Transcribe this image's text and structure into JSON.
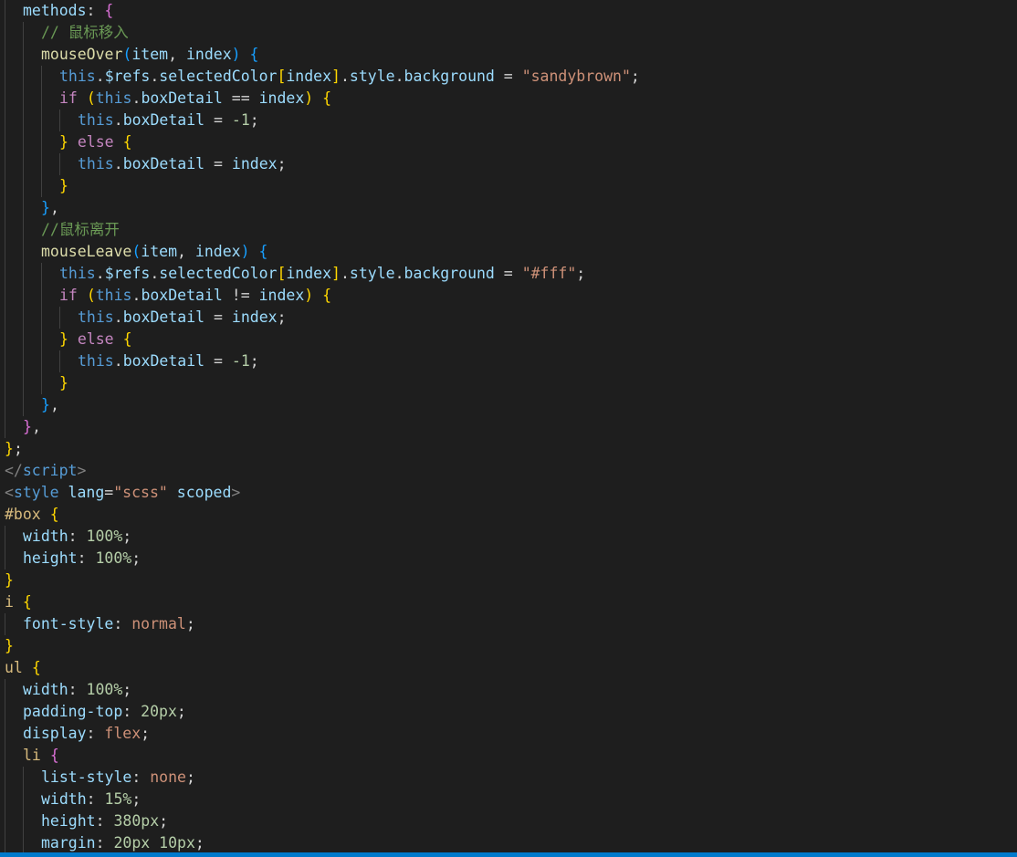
{
  "colors": {
    "background": "#1e1e1e",
    "statusbar": "#007acc",
    "indent_guide": "#404040",
    "default": "#d4d4d4",
    "keyword": "#569cd6",
    "control": "#c586c0",
    "function": "#dcdcaa",
    "variable": "#9cdcfe",
    "string": "#ce9178",
    "number": "#b5cea8",
    "comment": "#6a9955",
    "tag": "#808080",
    "selector": "#d7ba7d",
    "bracket1": "#ffd700",
    "bracket2": "#da70d6",
    "bracket3": "#179fff"
  },
  "code": {
    "lines": [
      {
        "indent": 1,
        "tokens": [
          [
            "methods",
            "variable"
          ],
          [
            ": ",
            "default"
          ],
          [
            "{",
            "bracket2"
          ]
        ]
      },
      {
        "indent": 2,
        "tokens": [
          [
            "// 鼠标移入",
            "comment"
          ]
        ]
      },
      {
        "indent": 2,
        "tokens": [
          [
            "mouseOver",
            "function"
          ],
          [
            "(",
            "bracket3"
          ],
          [
            "item",
            "variable"
          ],
          [
            ", ",
            "default"
          ],
          [
            "index",
            "variable"
          ],
          [
            ")",
            "bracket3"
          ],
          [
            " ",
            "default"
          ],
          [
            "{",
            "bracket3"
          ]
        ]
      },
      {
        "indent": 3,
        "tokens": [
          [
            "this",
            "keyword"
          ],
          [
            ".",
            "default"
          ],
          [
            "$refs",
            "variable"
          ],
          [
            ".",
            "default"
          ],
          [
            "selectedColor",
            "variable"
          ],
          [
            "[",
            "bracket1"
          ],
          [
            "index",
            "variable"
          ],
          [
            "]",
            "bracket1"
          ],
          [
            ".",
            "default"
          ],
          [
            "style",
            "variable"
          ],
          [
            ".",
            "default"
          ],
          [
            "background",
            "variable"
          ],
          [
            " = ",
            "default"
          ],
          [
            "\"sandybrown\"",
            "string"
          ],
          [
            ";",
            "default"
          ]
        ]
      },
      {
        "indent": 3,
        "tokens": [
          [
            "if",
            "control"
          ],
          [
            " ",
            "default"
          ],
          [
            "(",
            "bracket1"
          ],
          [
            "this",
            "keyword"
          ],
          [
            ".",
            "default"
          ],
          [
            "boxDetail",
            "variable"
          ],
          [
            " == ",
            "default"
          ],
          [
            "index",
            "variable"
          ],
          [
            ")",
            "bracket1"
          ],
          [
            " ",
            "default"
          ],
          [
            "{",
            "bracket1"
          ]
        ]
      },
      {
        "indent": 4,
        "tokens": [
          [
            "this",
            "keyword"
          ],
          [
            ".",
            "default"
          ],
          [
            "boxDetail",
            "variable"
          ],
          [
            " = ",
            "default"
          ],
          [
            "-1",
            "number"
          ],
          [
            ";",
            "default"
          ]
        ]
      },
      {
        "indent": 3,
        "tokens": [
          [
            "}",
            "bracket1"
          ],
          [
            " ",
            "default"
          ],
          [
            "else",
            "control"
          ],
          [
            " ",
            "default"
          ],
          [
            "{",
            "bracket1"
          ]
        ]
      },
      {
        "indent": 4,
        "tokens": [
          [
            "this",
            "keyword"
          ],
          [
            ".",
            "default"
          ],
          [
            "boxDetail",
            "variable"
          ],
          [
            " = ",
            "default"
          ],
          [
            "index",
            "variable"
          ],
          [
            ";",
            "default"
          ]
        ]
      },
      {
        "indent": 3,
        "tokens": [
          [
            "}",
            "bracket1"
          ]
        ]
      },
      {
        "indent": 2,
        "tokens": [
          [
            "}",
            "bracket3"
          ],
          [
            ",",
            "default"
          ]
        ]
      },
      {
        "indent": 2,
        "tokens": [
          [
            "//鼠标离开",
            "comment"
          ]
        ]
      },
      {
        "indent": 2,
        "tokens": [
          [
            "mouseLeave",
            "function"
          ],
          [
            "(",
            "bracket3"
          ],
          [
            "item",
            "variable"
          ],
          [
            ", ",
            "default"
          ],
          [
            "index",
            "variable"
          ],
          [
            ")",
            "bracket3"
          ],
          [
            " ",
            "default"
          ],
          [
            "{",
            "bracket3"
          ]
        ]
      },
      {
        "indent": 3,
        "tokens": [
          [
            "this",
            "keyword"
          ],
          [
            ".",
            "default"
          ],
          [
            "$refs",
            "variable"
          ],
          [
            ".",
            "default"
          ],
          [
            "selectedColor",
            "variable"
          ],
          [
            "[",
            "bracket1"
          ],
          [
            "index",
            "variable"
          ],
          [
            "]",
            "bracket1"
          ],
          [
            ".",
            "default"
          ],
          [
            "style",
            "variable"
          ],
          [
            ".",
            "default"
          ],
          [
            "background",
            "variable"
          ],
          [
            " = ",
            "default"
          ],
          [
            "\"#fff\"",
            "string"
          ],
          [
            ";",
            "default"
          ]
        ]
      },
      {
        "indent": 3,
        "tokens": [
          [
            "if",
            "control"
          ],
          [
            " ",
            "default"
          ],
          [
            "(",
            "bracket1"
          ],
          [
            "this",
            "keyword"
          ],
          [
            ".",
            "default"
          ],
          [
            "boxDetail",
            "variable"
          ],
          [
            " != ",
            "default"
          ],
          [
            "index",
            "variable"
          ],
          [
            ")",
            "bracket1"
          ],
          [
            " ",
            "default"
          ],
          [
            "{",
            "bracket1"
          ]
        ]
      },
      {
        "indent": 4,
        "tokens": [
          [
            "this",
            "keyword"
          ],
          [
            ".",
            "default"
          ],
          [
            "boxDetail",
            "variable"
          ],
          [
            " = ",
            "default"
          ],
          [
            "index",
            "variable"
          ],
          [
            ";",
            "default"
          ]
        ]
      },
      {
        "indent": 3,
        "tokens": [
          [
            "}",
            "bracket1"
          ],
          [
            " ",
            "default"
          ],
          [
            "else",
            "control"
          ],
          [
            " ",
            "default"
          ],
          [
            "{",
            "bracket1"
          ]
        ]
      },
      {
        "indent": 4,
        "tokens": [
          [
            "this",
            "keyword"
          ],
          [
            ".",
            "default"
          ],
          [
            "boxDetail",
            "variable"
          ],
          [
            " = ",
            "default"
          ],
          [
            "-1",
            "number"
          ],
          [
            ";",
            "default"
          ]
        ]
      },
      {
        "indent": 3,
        "tokens": [
          [
            "}",
            "bracket1"
          ]
        ]
      },
      {
        "indent": 2,
        "tokens": [
          [
            "}",
            "bracket3"
          ],
          [
            ",",
            "default"
          ]
        ]
      },
      {
        "indent": 1,
        "tokens": [
          [
            "}",
            "bracket2"
          ],
          [
            ",",
            "default"
          ]
        ]
      },
      {
        "indent": 0,
        "tokens": [
          [
            "}",
            "bracket1"
          ],
          [
            ";",
            "default"
          ]
        ]
      },
      {
        "indent": 0,
        "tokens": [
          [
            "</",
            "tag"
          ],
          [
            "script",
            "keyword"
          ],
          [
            ">",
            "tag"
          ]
        ]
      },
      {
        "indent": 0,
        "tokens": [
          [
            "<",
            "tag"
          ],
          [
            "style",
            "keyword"
          ],
          [
            " ",
            "default"
          ],
          [
            "lang",
            "variable"
          ],
          [
            "=",
            "default"
          ],
          [
            "\"scss\"",
            "string"
          ],
          [
            " ",
            "default"
          ],
          [
            "scoped",
            "variable"
          ],
          [
            ">",
            "tag"
          ]
        ]
      },
      {
        "indent": 0,
        "tokens": [
          [
            "#box",
            "selector"
          ],
          [
            " ",
            "default"
          ],
          [
            "{",
            "bracket1"
          ]
        ]
      },
      {
        "indent": 1,
        "tokens": [
          [
            "width",
            "variable"
          ],
          [
            ": ",
            "default"
          ],
          [
            "100%",
            "number"
          ],
          [
            ";",
            "default"
          ]
        ]
      },
      {
        "indent": 1,
        "tokens": [
          [
            "height",
            "variable"
          ],
          [
            ": ",
            "default"
          ],
          [
            "100%",
            "number"
          ],
          [
            ";",
            "default"
          ]
        ]
      },
      {
        "indent": 0,
        "tokens": [
          [
            "}",
            "bracket1"
          ]
        ]
      },
      {
        "indent": 0,
        "tokens": [
          [
            "i",
            "selector"
          ],
          [
            " ",
            "default"
          ],
          [
            "{",
            "bracket1"
          ]
        ]
      },
      {
        "indent": 1,
        "tokens": [
          [
            "font-style",
            "variable"
          ],
          [
            ": ",
            "default"
          ],
          [
            "normal",
            "string"
          ],
          [
            ";",
            "default"
          ]
        ]
      },
      {
        "indent": 0,
        "tokens": [
          [
            "}",
            "bracket1"
          ]
        ]
      },
      {
        "indent": 0,
        "tokens": [
          [
            "ul",
            "selector"
          ],
          [
            " ",
            "default"
          ],
          [
            "{",
            "bracket1"
          ]
        ]
      },
      {
        "indent": 1,
        "tokens": [
          [
            "width",
            "variable"
          ],
          [
            ": ",
            "default"
          ],
          [
            "100%",
            "number"
          ],
          [
            ";",
            "default"
          ]
        ]
      },
      {
        "indent": 1,
        "tokens": [
          [
            "padding-top",
            "variable"
          ],
          [
            ": ",
            "default"
          ],
          [
            "20px",
            "number"
          ],
          [
            ";",
            "default"
          ]
        ]
      },
      {
        "indent": 1,
        "tokens": [
          [
            "display",
            "variable"
          ],
          [
            ": ",
            "default"
          ],
          [
            "flex",
            "string"
          ],
          [
            ";",
            "default"
          ]
        ]
      },
      {
        "indent": 1,
        "tokens": [
          [
            "li",
            "selector"
          ],
          [
            " ",
            "default"
          ],
          [
            "{",
            "bracket2"
          ]
        ]
      },
      {
        "indent": 2,
        "tokens": [
          [
            "list-style",
            "variable"
          ],
          [
            ": ",
            "default"
          ],
          [
            "none",
            "string"
          ],
          [
            ";",
            "default"
          ]
        ]
      },
      {
        "indent": 2,
        "tokens": [
          [
            "width",
            "variable"
          ],
          [
            ": ",
            "default"
          ],
          [
            "15%",
            "number"
          ],
          [
            ";",
            "default"
          ]
        ]
      },
      {
        "indent": 2,
        "tokens": [
          [
            "height",
            "variable"
          ],
          [
            ": ",
            "default"
          ],
          [
            "380px",
            "number"
          ],
          [
            ";",
            "default"
          ]
        ]
      },
      {
        "indent": 2,
        "tokens": [
          [
            "margin",
            "variable"
          ],
          [
            ": ",
            "default"
          ],
          [
            "20px 10px",
            "number"
          ],
          [
            ";",
            "default"
          ]
        ]
      }
    ]
  }
}
